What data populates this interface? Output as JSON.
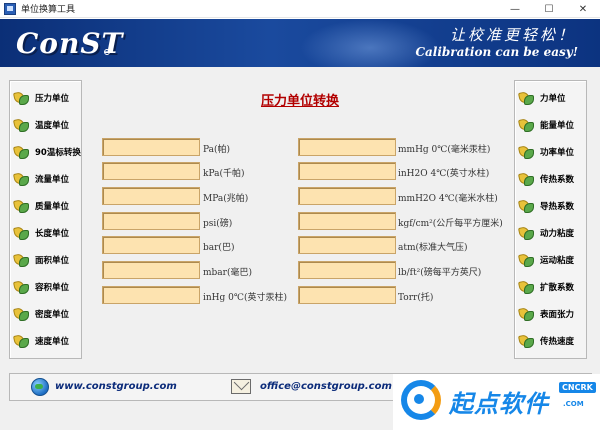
{
  "window": {
    "title": "单位换算工具",
    "controls": {
      "minimize": "—",
      "maximize": "☐",
      "close": "✕"
    }
  },
  "banner": {
    "logo": "ConST",
    "slogan_cn": "让校准更轻松！",
    "slogan_en": "Calibration can be easy!"
  },
  "main": {
    "title": "压力单位转换",
    "left_units": [
      "Pa(帕)",
      "kPa(千帕)",
      "MPa(兆帕)",
      "psi(磅)",
      "bar(巴)",
      "mbar(毫巴)",
      "inHg 0℃(英寸汞柱)"
    ],
    "right_units": [
      "mmHg 0℃(毫米汞柱)",
      "inH2O 4℃(英寸水柱)",
      "mmH2O 4℃(毫米水柱)",
      "kgf/cm²(公斤每平方厘米)",
      "atm(标准大气压)",
      "lb/ft²(磅每平方英尺)",
      "Torr(托)"
    ],
    "left_values": [
      "",
      "",
      "",
      "",
      "",
      "",
      ""
    ],
    "right_values": [
      "",
      "",
      "",
      "",
      "",
      "",
      ""
    ]
  },
  "sidebar_left": {
    "items": [
      "压力单位",
      "温度单位",
      "90温标转换",
      "流量单位",
      "质量单位",
      "长度单位",
      "面积单位",
      "容积单位",
      "密度单位",
      "速度单位"
    ]
  },
  "sidebar_right": {
    "items": [
      "力单位",
      "能量单位",
      "功率单位",
      "传热系数",
      "导热系数",
      "动力粘度",
      "运动粘度",
      "扩散系数",
      "表面张力",
      "传热速度"
    ]
  },
  "footer": {
    "website": "www.constgroup.com",
    "email": "office@constgroup.com"
  },
  "watermark": {
    "text": "起点软件",
    "tag": "CNCRK",
    "sub": ".COM"
  },
  "colors": {
    "banner": "#0b2f77",
    "title_red": "#b20000",
    "field_fill": "#fde3b0",
    "link_blue": "#0b2b7a"
  }
}
